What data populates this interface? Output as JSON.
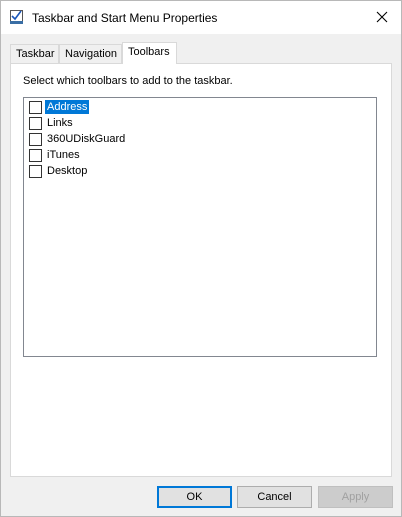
{
  "window": {
    "title": "Taskbar and Start Menu Properties",
    "icon": "taskbar-properties-icon"
  },
  "tabs": [
    {
      "label": "Taskbar",
      "active": false
    },
    {
      "label": "Navigation",
      "active": false
    },
    {
      "label": "Toolbars",
      "active": true
    }
  ],
  "toolbars_panel": {
    "instruction": "Select which toolbars to add to the taskbar.",
    "items": [
      {
        "label": "Address",
        "checked": false,
        "selected": true
      },
      {
        "label": "Links",
        "checked": false,
        "selected": false
      },
      {
        "label": "360UDiskGuard",
        "checked": false,
        "selected": false
      },
      {
        "label": "iTunes",
        "checked": false,
        "selected": false
      },
      {
        "label": "Desktop",
        "checked": false,
        "selected": false
      }
    ]
  },
  "buttons": {
    "ok": "OK",
    "cancel": "Cancel",
    "apply": "Apply"
  },
  "colors": {
    "selection": "#0078d7",
    "dialog_bg": "#f0f0f0"
  }
}
